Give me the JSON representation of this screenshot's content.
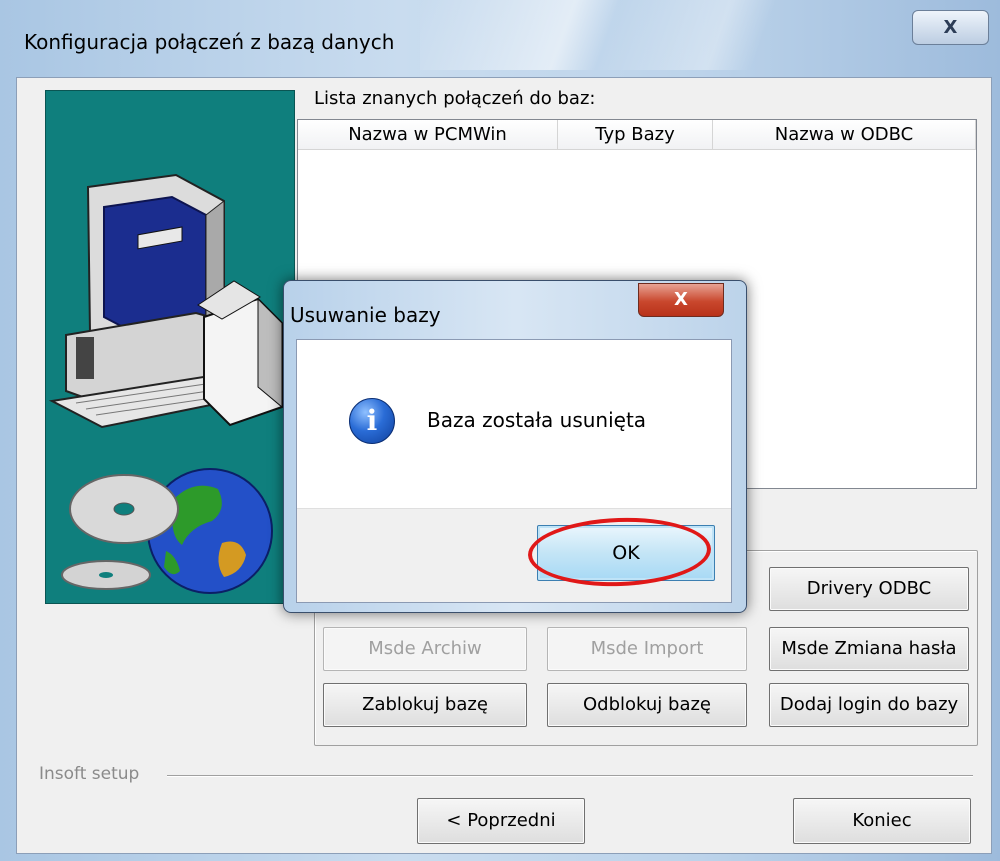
{
  "window": {
    "title": "Konfiguracja połączeń z bazą danych",
    "close_glyph": "X"
  },
  "list": {
    "label": "Lista znanych połączeń do baz:",
    "columns": [
      "Nazwa w PCMWin",
      "Typ Bazy",
      "Nazwa w ODBC"
    ],
    "rows": []
  },
  "buttons": {
    "drivers": "Drivery ODBC",
    "msde_archive": "Msde Archiw",
    "msde_import": "Msde Import",
    "msde_password": "Msde Zmiana hasła",
    "lock_db": "Zablokuj bazę",
    "unlock_db": "Odblokuj bazę",
    "add_login": "Dodaj login do bazy"
  },
  "footer": {
    "setup_label": "Insoft setup",
    "prev": "< Poprzedni",
    "finish": "Koniec"
  },
  "dialog": {
    "title": "Usuwanie bazy",
    "close_glyph": "X",
    "icon": "info-icon",
    "message": "Baza została usunięta",
    "ok": "OK"
  },
  "colors": {
    "art_panel": "#0f7f7d",
    "highlight_ring": "#e01818",
    "dialog_close": "#c9472d"
  }
}
